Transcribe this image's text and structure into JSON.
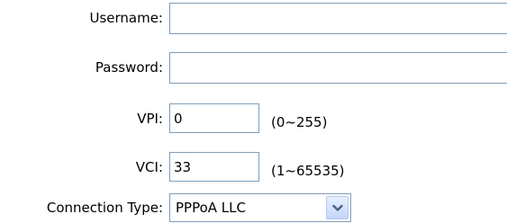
{
  "form": {
    "username": {
      "label": "Username:",
      "value": ""
    },
    "password": {
      "label": "Password:",
      "value": ""
    },
    "vpi": {
      "label": "VPI:",
      "value": "0",
      "range": "(0~255)"
    },
    "vci": {
      "label": "VCI:",
      "value": "33",
      "range": "(1~65535)"
    },
    "connection_type": {
      "label": "Connection Type:",
      "selected": "PPPoA LLC",
      "dropdown_icon": "chevron-down-icon"
    }
  },
  "colors": {
    "field_border": "#7f9db9",
    "dropdown_button": "#c6d6fa",
    "dropdown_arrow": "#4d6185"
  }
}
